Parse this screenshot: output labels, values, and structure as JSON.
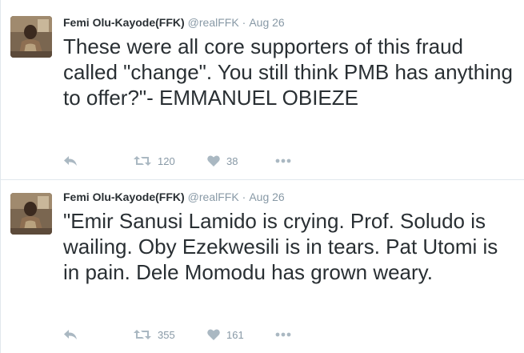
{
  "colors": {
    "text": "#292f33",
    "muted": "#8899a6",
    "icon": "#aab8c2",
    "divider": "#e1e8ed"
  },
  "tweets": [
    {
      "fullname": "Femi Olu-Kayode(FFK)",
      "username": "@realFFK",
      "separator": "·",
      "time": "Aug 26",
      "text": "These were all core supporters of this fraud called \"change\". You still think PMB has anything to offer?\"- EMMANUEL OBIEZE",
      "retweets": "120",
      "likes": "38",
      "icons": {
        "reply": "reply-icon",
        "retweet": "retweet-icon",
        "like": "heart-icon",
        "more": "more-dots-icon"
      }
    },
    {
      "fullname": "Femi Olu-Kayode(FFK)",
      "username": "@realFFK",
      "separator": "·",
      "time": "Aug 26",
      "text": "\"Emir Sanusi Lamido is crying. Prof. Soludo is wailing. Oby Ezekwesili is in tears. Pat Utomi is in pain. Dele Momodu has grown weary.",
      "retweets": "355",
      "likes": "161",
      "icons": {
        "reply": "reply-icon",
        "retweet": "retweet-icon",
        "like": "heart-icon",
        "more": "more-dots-icon"
      }
    }
  ]
}
